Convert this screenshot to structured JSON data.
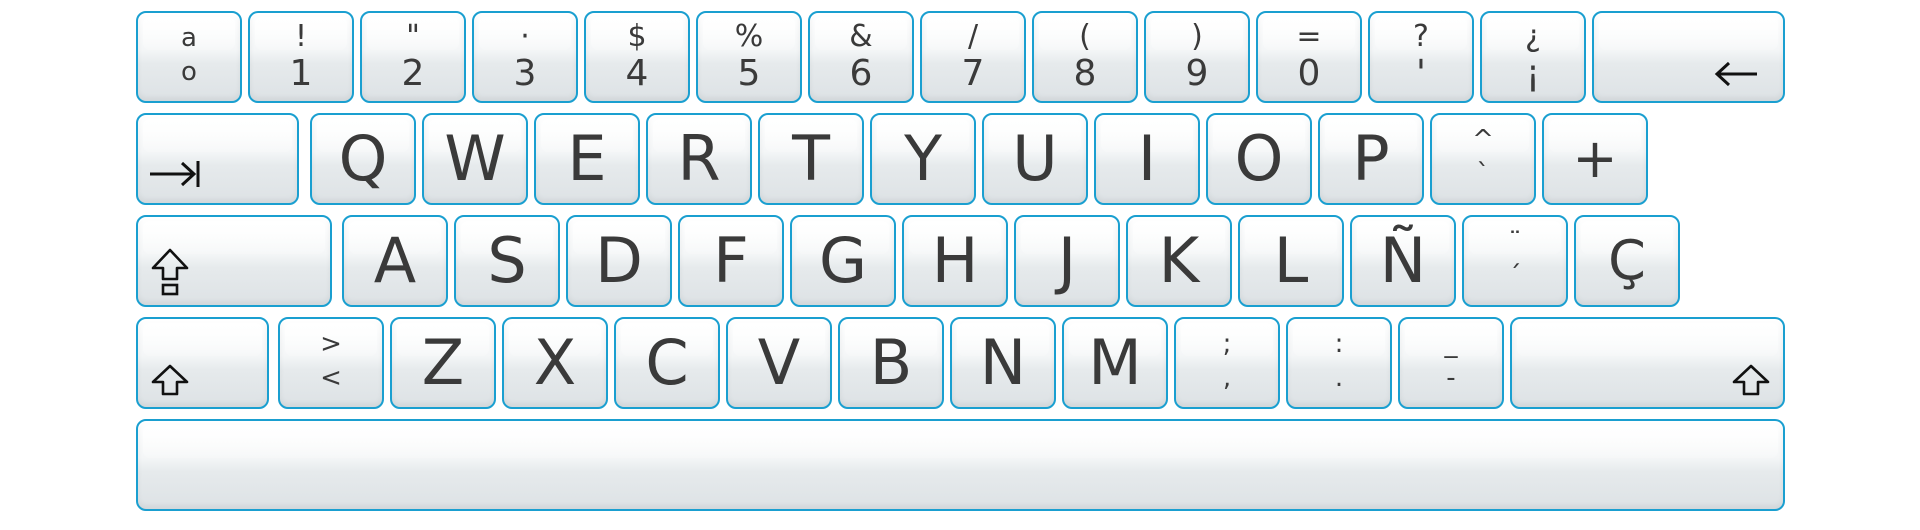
{
  "keyboard": {
    "row1": [
      {
        "top": "a",
        "bottom": "o"
      },
      {
        "top": "!",
        "bottom": "1"
      },
      {
        "top": "\"",
        "bottom": "2"
      },
      {
        "top": "·",
        "bottom": "3"
      },
      {
        "top": "$",
        "bottom": "4"
      },
      {
        "top": "%",
        "bottom": "5"
      },
      {
        "top": "&",
        "bottom": "6"
      },
      {
        "top": "/",
        "bottom": "7"
      },
      {
        "top": "(",
        "bottom": "8"
      },
      {
        "top": ")",
        "bottom": "9"
      },
      {
        "top": "=",
        "bottom": "0"
      },
      {
        "top": "?",
        "bottom": "'"
      },
      {
        "top": "¿",
        "bottom": "¡"
      }
    ],
    "row2": [
      "Q",
      "W",
      "E",
      "R",
      "T",
      "Y",
      "U",
      "I",
      "O",
      "P"
    ],
    "row2_extra": [
      {
        "top": "^",
        "bottom": "`"
      },
      {
        "main": "+"
      }
    ],
    "row3": [
      "A",
      "S",
      "D",
      "F",
      "G",
      "H",
      "J",
      "K",
      "L",
      "Ñ"
    ],
    "row3_extra": [
      {
        "top": "¨",
        "bottom": "´"
      },
      {
        "main": "Ç"
      }
    ],
    "row4_less": {
      "top": ">",
      "bottom": "<"
    },
    "row4": [
      "Z",
      "X",
      "C",
      "V",
      "B",
      "N",
      "M"
    ],
    "row4_extra": [
      {
        "top": ";",
        "bottom": ","
      },
      {
        "top": ":",
        "bottom": "."
      },
      {
        "top": "_",
        "bottom": "-"
      }
    ],
    "icons": {
      "backspace": "backspace-arrow-icon",
      "tab": "tab-arrow-icon",
      "caps_lock": "caps-lock-icon",
      "shift_left": "shift-icon",
      "shift_right": "shift-icon"
    },
    "colors": {
      "key_border": "#1a9fd0",
      "key_text": "#3a3a3a"
    }
  }
}
